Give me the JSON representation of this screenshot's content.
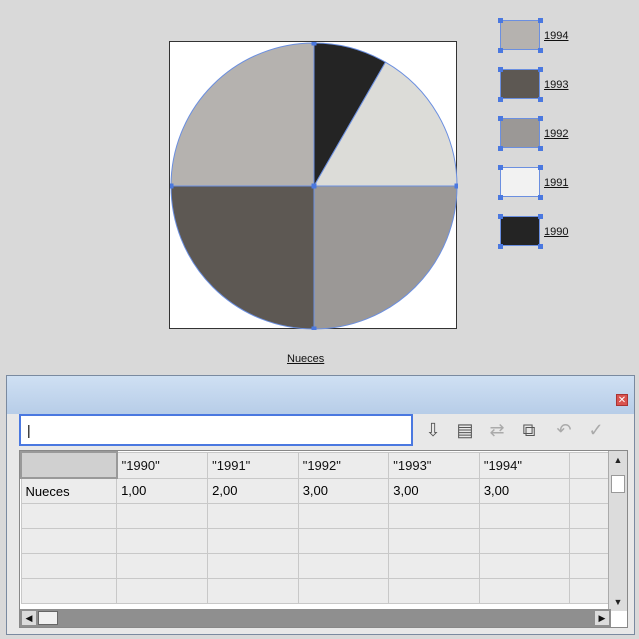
{
  "chart_data": {
    "type": "pie",
    "categories": [
      "1990",
      "1991",
      "1992",
      "1993",
      "1994"
    ],
    "values": [
      1,
      2,
      3,
      3,
      3
    ],
    "series": [
      {
        "name": "Nueces",
        "values": [
          1,
          2,
          3,
          3,
          3
        ]
      }
    ],
    "colors": [
      "#242424",
      "#dcdcd8",
      "#9b9896",
      "#5d5853",
      "#b5b2af"
    ],
    "legend_position": "right",
    "pie_label": "Nueces"
  },
  "legend": {
    "items": [
      {
        "label": "1994",
        "color": "#b5b2af"
      },
      {
        "label": "1993",
        "color": "#5d5853"
      },
      {
        "label": "1992",
        "color": "#9b9896"
      },
      {
        "label": "1991",
        "color": "#f2f2f2"
      },
      {
        "label": "1990",
        "color": "#242424"
      }
    ]
  },
  "panel": {
    "close_icon": "close-icon",
    "input_value": "|",
    "toolbar_icons": [
      "import-data-icon",
      "cell-style-icon",
      "switch-row-column-icon",
      "swap-xy-icon",
      "revert-icon",
      "apply-icon"
    ],
    "table": {
      "header": [
        "",
        "\"1990\"",
        "\"1991\"",
        "\"1992\"",
        "\"1993\"",
        "\"1994\"",
        ""
      ],
      "rows": [
        [
          "Nueces",
          "1,00",
          "2,00",
          "3,00",
          "3,00",
          "3,00",
          ""
        ],
        [
          "",
          "",
          "",
          "",
          "",
          "",
          ""
        ],
        [
          "",
          "",
          "",
          "",
          "",
          "",
          ""
        ],
        [
          "",
          "",
          "",
          "",
          "",
          "",
          ""
        ],
        [
          "",
          "",
          "",
          "",
          "",
          "",
          ""
        ]
      ]
    }
  }
}
